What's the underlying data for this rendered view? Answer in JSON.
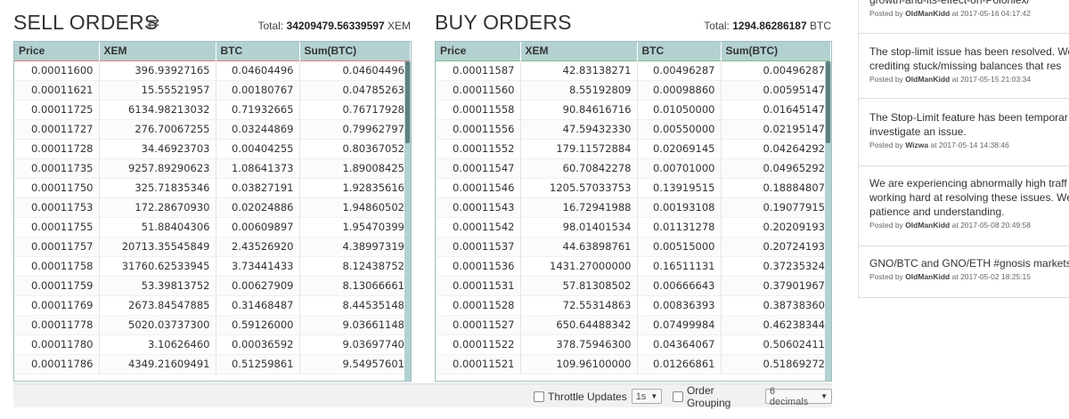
{
  "sell": {
    "title": "SELL ORDERS",
    "swap_icon": "⇄",
    "total_label": "Total:",
    "total_value": "34209479.56339597",
    "total_unit": "XEM",
    "columns": [
      "Price",
      "XEM",
      "BTC",
      "Sum(BTC)"
    ],
    "rows": [
      [
        "0.00011600",
        "396.93927165",
        "0.04604496",
        "0.04604496"
      ],
      [
        "0.00011621",
        "15.55521957",
        "0.00180767",
        "0.04785263"
      ],
      [
        "0.00011725",
        "6134.98213032",
        "0.71932665",
        "0.76717928"
      ],
      [
        "0.00011727",
        "276.70067255",
        "0.03244869",
        "0.79962797"
      ],
      [
        "0.00011728",
        "34.46923703",
        "0.00404255",
        "0.80367052"
      ],
      [
        "0.00011735",
        "9257.89290623",
        "1.08641373",
        "1.89008425"
      ],
      [
        "0.00011750",
        "325.71835346",
        "0.03827191",
        "1.92835616"
      ],
      [
        "0.00011753",
        "172.28670930",
        "0.02024886",
        "1.94860502"
      ],
      [
        "0.00011755",
        "51.88404306",
        "0.00609897",
        "1.95470399"
      ],
      [
        "0.00011757",
        "20713.35545849",
        "2.43526920",
        "4.38997319"
      ],
      [
        "0.00011758",
        "31760.62533945",
        "3.73441433",
        "8.12438752"
      ],
      [
        "0.00011759",
        "53.39813752",
        "0.00627909",
        "8.13066661"
      ],
      [
        "0.00011769",
        "2673.84547885",
        "0.31468487",
        "8.44535148"
      ],
      [
        "0.00011778",
        "5020.03737300",
        "0.59126000",
        "9.03661148"
      ],
      [
        "0.00011780",
        "3.10626460",
        "0.00036592",
        "9.03697740"
      ],
      [
        "0.00011786",
        "4349.21609491",
        "0.51259861",
        "9.54957601"
      ]
    ]
  },
  "buy": {
    "title": "BUY ORDERS",
    "total_label": "Total:",
    "total_value": "1294.86286187",
    "total_unit": "BTC",
    "columns": [
      "Price",
      "XEM",
      "BTC",
      "Sum(BTC)"
    ],
    "rows": [
      [
        "0.00011587",
        "42.83138271",
        "0.00496287",
        "0.00496287"
      ],
      [
        "0.00011560",
        "8.55192809",
        "0.00098860",
        "0.00595147"
      ],
      [
        "0.00011558",
        "90.84616716",
        "0.01050000",
        "0.01645147"
      ],
      [
        "0.00011556",
        "47.59432330",
        "0.00550000",
        "0.02195147"
      ],
      [
        "0.00011552",
        "179.11572884",
        "0.02069145",
        "0.04264292"
      ],
      [
        "0.00011547",
        "60.70842278",
        "0.00701000",
        "0.04965292"
      ],
      [
        "0.00011546",
        "1205.57033753",
        "0.13919515",
        "0.18884807"
      ],
      [
        "0.00011543",
        "16.72941988",
        "0.00193108",
        "0.19077915"
      ],
      [
        "0.00011542",
        "98.01401534",
        "0.01131278",
        "0.20209193"
      ],
      [
        "0.00011537",
        "44.63898761",
        "0.00515000",
        "0.20724193"
      ],
      [
        "0.00011536",
        "1431.27000000",
        "0.16511131",
        "0.37235324"
      ],
      [
        "0.00011531",
        "57.81308502",
        "0.00666643",
        "0.37901967"
      ],
      [
        "0.00011528",
        "72.55314863",
        "0.00836393",
        "0.38738360"
      ],
      [
        "0.00011527",
        "650.64488342",
        "0.07499984",
        "0.46238344"
      ],
      [
        "0.00011522",
        "378.75946300",
        "0.04364067",
        "0.50602411"
      ],
      [
        "0.00011521",
        "109.96100000",
        "0.01266861",
        "0.51869272"
      ]
    ]
  },
  "footer": {
    "throttle_label": "Throttle Updates",
    "throttle_value": "1s",
    "grouping_label": "Order Grouping",
    "grouping_value": "6 decimals",
    "caret": "▼"
  },
  "news": [
    {
      "text": "growth-and-its-effect-on-Poloniex/",
      "posted_by": "Posted by",
      "author": "OldManKidd",
      "date": "at 2017-05-16 04:17:42"
    },
    {
      "text": "The stop-limit issue has been resolved. We",
      "text2": "crediting stuck/missing balances that res",
      "posted_by": "Posted by",
      "author": "OldManKidd",
      "date": "at 2017-05-15 21:03:34"
    },
    {
      "text": "The Stop-Limit feature has been temporar",
      "text2": "investigate an issue.",
      "posted_by": "Posted by",
      "author": "Wizwa",
      "date": "at 2017-05-14 14:38:46"
    },
    {
      "text": "We are experiencing abnormally high traff",
      "text2": "working hard at resolving these issues. We",
      "text3": "patience and understanding.",
      "posted_by": "Posted by",
      "author": "OldManKidd",
      "date": "at 2017-05-08 20:49:58"
    },
    {
      "text": "GNO/BTC and GNO/ETH #gnosis markets",
      "posted_by": "Posted by",
      "author": "OldManKidd",
      "date": "at 2017-05-02 18:25:15"
    }
  ]
}
